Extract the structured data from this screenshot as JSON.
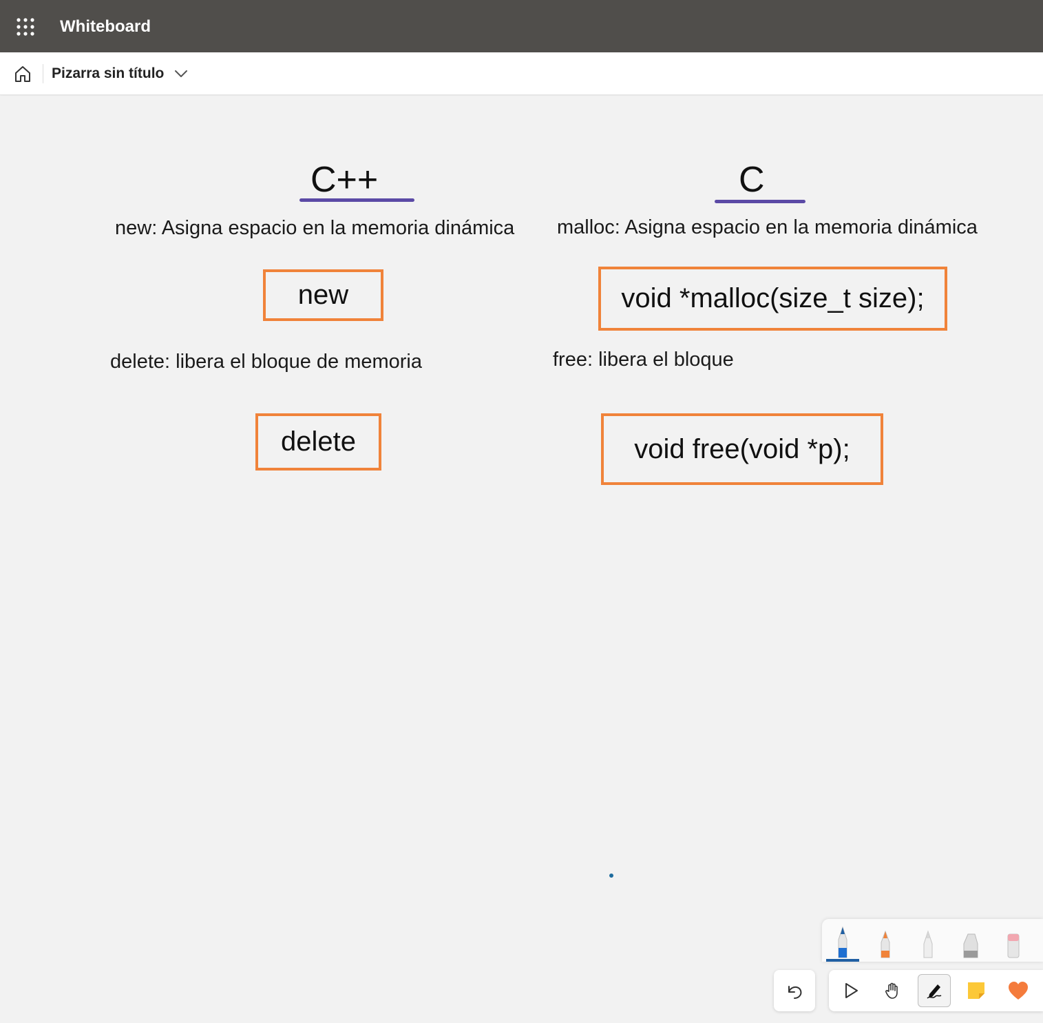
{
  "app": {
    "title": "Whiteboard",
    "board_title": "Pizarra sin título"
  },
  "board": {
    "cpp": {
      "heading": "C++",
      "new_desc": "new: Asigna espacio en la memoria dinámica",
      "new_code": "new",
      "delete_desc": "delete: libera el bloque de memoria",
      "delete_code": "delete"
    },
    "c": {
      "heading": "C",
      "malloc_desc": "malloc: Asigna espacio en la memoria dinámica",
      "malloc_code": "void *malloc(size_t size);",
      "free_desc": "free: libera el bloque",
      "free_code": "void free(void *p);"
    }
  },
  "colors": {
    "titlebar": "#504e4b",
    "box_border": "#f0833a",
    "underline": "#5b4aa6",
    "canvas": "#f2f2f2"
  },
  "pens": [
    "blue-pen",
    "orange-highlighter-pen",
    "white-pen",
    "gray-pen",
    "pink-eraser"
  ],
  "tools": [
    "undo-icon",
    "select-icon",
    "pan-hand-icon",
    "ink-pen-icon",
    "sticky-note-icon",
    "reaction-heart-icon"
  ]
}
